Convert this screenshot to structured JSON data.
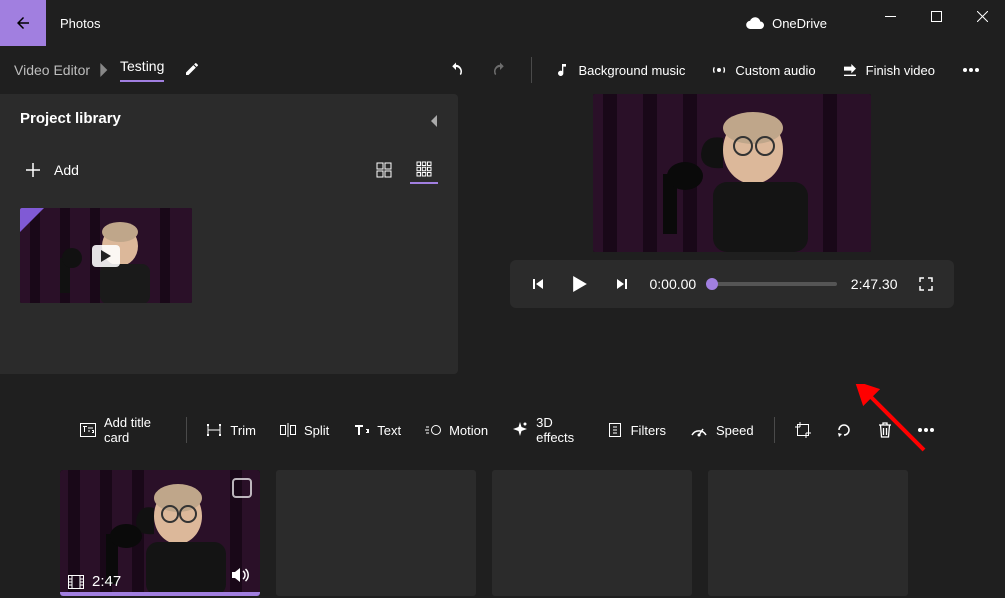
{
  "app": {
    "title": "Photos",
    "onedrive": "OneDrive"
  },
  "breadcrumb": {
    "root": "Video Editor",
    "project": "Testing"
  },
  "toolbar": {
    "background_music": "Background music",
    "custom_audio": "Custom audio",
    "finish_video": "Finish video"
  },
  "library": {
    "title": "Project library",
    "add": "Add"
  },
  "player": {
    "current": "0:00.00",
    "total": "2:47.30"
  },
  "storyboard": {
    "addTitle": "Add title card",
    "trim": "Trim",
    "split": "Split",
    "text": "Text",
    "motion": "Motion",
    "fx3d": "3D effects",
    "filters": "Filters",
    "speed": "Speed"
  },
  "clip": {
    "duration": "2:47"
  }
}
